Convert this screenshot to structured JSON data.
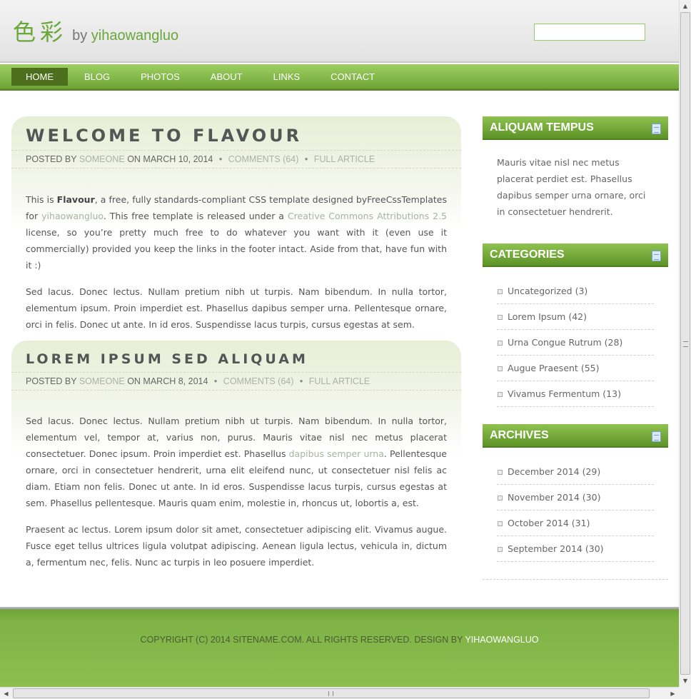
{
  "header": {
    "logo_cn": "色彩",
    "logo_by": "by",
    "logo_name": "yihaowangluo",
    "search_value": ""
  },
  "nav": {
    "items": [
      {
        "label": "HOME",
        "active": true
      },
      {
        "label": "BLOG"
      },
      {
        "label": "PHOTOS"
      },
      {
        "label": "ABOUT"
      },
      {
        "label": "LINKS"
      },
      {
        "label": "CONTACT"
      }
    ]
  },
  "posts": [
    {
      "title": "WELCOME TO FLAVOUR",
      "posted_by": "POSTED BY",
      "author": "SOMEONE",
      "on": "ON MARCH 10, 2014",
      "comments": "COMMENTS (64)",
      "full": "FULL ARTICLE",
      "p1_a": "This is ",
      "p1_b": "Flavour",
      "p1_c": ", a free, fully standards-compliant CSS template designed byFreeCssTemplates for ",
      "p1_link1": "yihaowangluo",
      "p1_d": ". This free template is released under a ",
      "p1_link2": "Creative Commons Attributions 2.5",
      "p1_e": " license, so you’re pretty much free to do whatever you want with it (even use it commercially) provided you keep the links in the footer intact. Aside from that, have fun with it :)",
      "p2": "Sed lacus. Donec lectus. Nullam pretium nibh ut turpis. Nam bibendum. In nulla tortor, elementum ipsum. Proin imperdiet est. Phasellus dapibus semper urna. Pellentesque ornare, orci in felis. Donec ut ante. In id eros. Suspendisse lacus turpis, cursus egestas at sem."
    },
    {
      "title": "LOREM IPSUM SED ALIQUAM",
      "posted_by": "POSTED BY",
      "author": "SOMEONE",
      "on": "ON MARCH 8, 2014",
      "comments": "COMMENTS (64)",
      "full": "FULL ARTICLE",
      "p1_a": "Sed lacus. Donec lectus. Nullam pretium nibh ut turpis. Nam bibendum. In nulla tortor, elementum vel, tempor at, varius non, purus. Mauris vitae nisl nec metus placerat consectetuer. Donec ipsum. Proin imperdiet est. Phasellus ",
      "p1_link": "dapibus semper urna",
      "p1_b": ". Pellentesque ornare, orci in consectetuer hendrerit, urna elit eleifend nunc, ut consectetuer nisl felis ac diam. Etiam non felis. Donec ut ante. In id eros. Suspendisse lacus turpis, cursus egestas at sem. Phasellus pellentesque. Mauris quam enim, molestie in, rhoncus ut, lobortis a, est.",
      "p2": "Praesent ac lectus. Lorem ipsum dolor sit amet, consectetuer adipiscing elit. Vivamus augue. Fusce eget tellus ultrices ligula volutpat adipiscing. Aenean ligula lectus, vehicula in, dictum a, fermentum nec, felis. Nunc ac turpis in leo posuere imperdiet."
    }
  ],
  "sidebar": {
    "box1": {
      "title": "ALIQUAM TEMPUS",
      "text": "Mauris vitae nisl nec metus placerat perdiet est. Phasellus dapibus semper urna ornare, orci in consectetuer hendrerit."
    },
    "categories": {
      "title": "CATEGORIES",
      "items": [
        {
          "label": "Uncategorized",
          "count": "(3)"
        },
        {
          "label": "Lorem Ipsum",
          "count": "(42)"
        },
        {
          "label": "Urna Congue Rutrum",
          "count": "(28)"
        },
        {
          "label": "Augue Praesent",
          "count": "(55)"
        },
        {
          "label": "Vivamus Fermentum",
          "count": "(13)"
        }
      ]
    },
    "archives": {
      "title": "ARCHIVES",
      "items": [
        {
          "label": "December 2014",
          "count": "(29)"
        },
        {
          "label": "November 2014",
          "count": "(30)"
        },
        {
          "label": "October 2014",
          "count": "(31)"
        },
        {
          "label": "September 2014",
          "count": "(30)"
        }
      ]
    }
  },
  "footer": {
    "text": "COPYRIGHT (C) 2014 SITENAME.COM. ALL RIGHTS RESERVED. DESIGN BY ",
    "link": "YIHAOWANGLUO"
  },
  "colors": {
    "accent_green": "#6ea536",
    "nav_active": "#4d6f1d",
    "link_muted": "#a8b4a1"
  }
}
